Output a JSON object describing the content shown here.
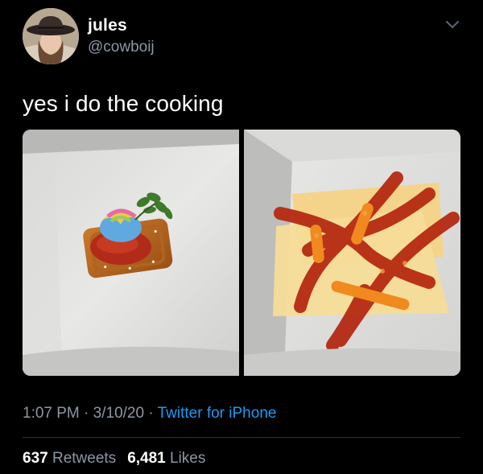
{
  "author": {
    "display_name": "jules",
    "handle": "@cowboij",
    "avatar_icon": "profile-photo"
  },
  "menu_icon": "chevron-down-icon",
  "tweet_text": "yes i do the cooking",
  "media": {
    "images": [
      {
        "depicts": "pretzel-with-cereal-marshmallow-and-herb-on-white-plate"
      },
      {
        "depicts": "cheese-slices-with-ketchup-and-cheese-puffs-on-white-plate"
      }
    ]
  },
  "meta": {
    "time": "1:07 PM",
    "separator": " · ",
    "date": "3/10/20",
    "source": "Twitter for iPhone"
  },
  "stats": {
    "retweets_count": "637",
    "retweets_label": "Retweets",
    "likes_count": "6,481",
    "likes_label": "Likes"
  },
  "colors": {
    "background": "#000000",
    "text": "#ffffff",
    "secondary_text": "#8b98a5",
    "link": "#1d9bf0",
    "divider": "#2f3336"
  }
}
